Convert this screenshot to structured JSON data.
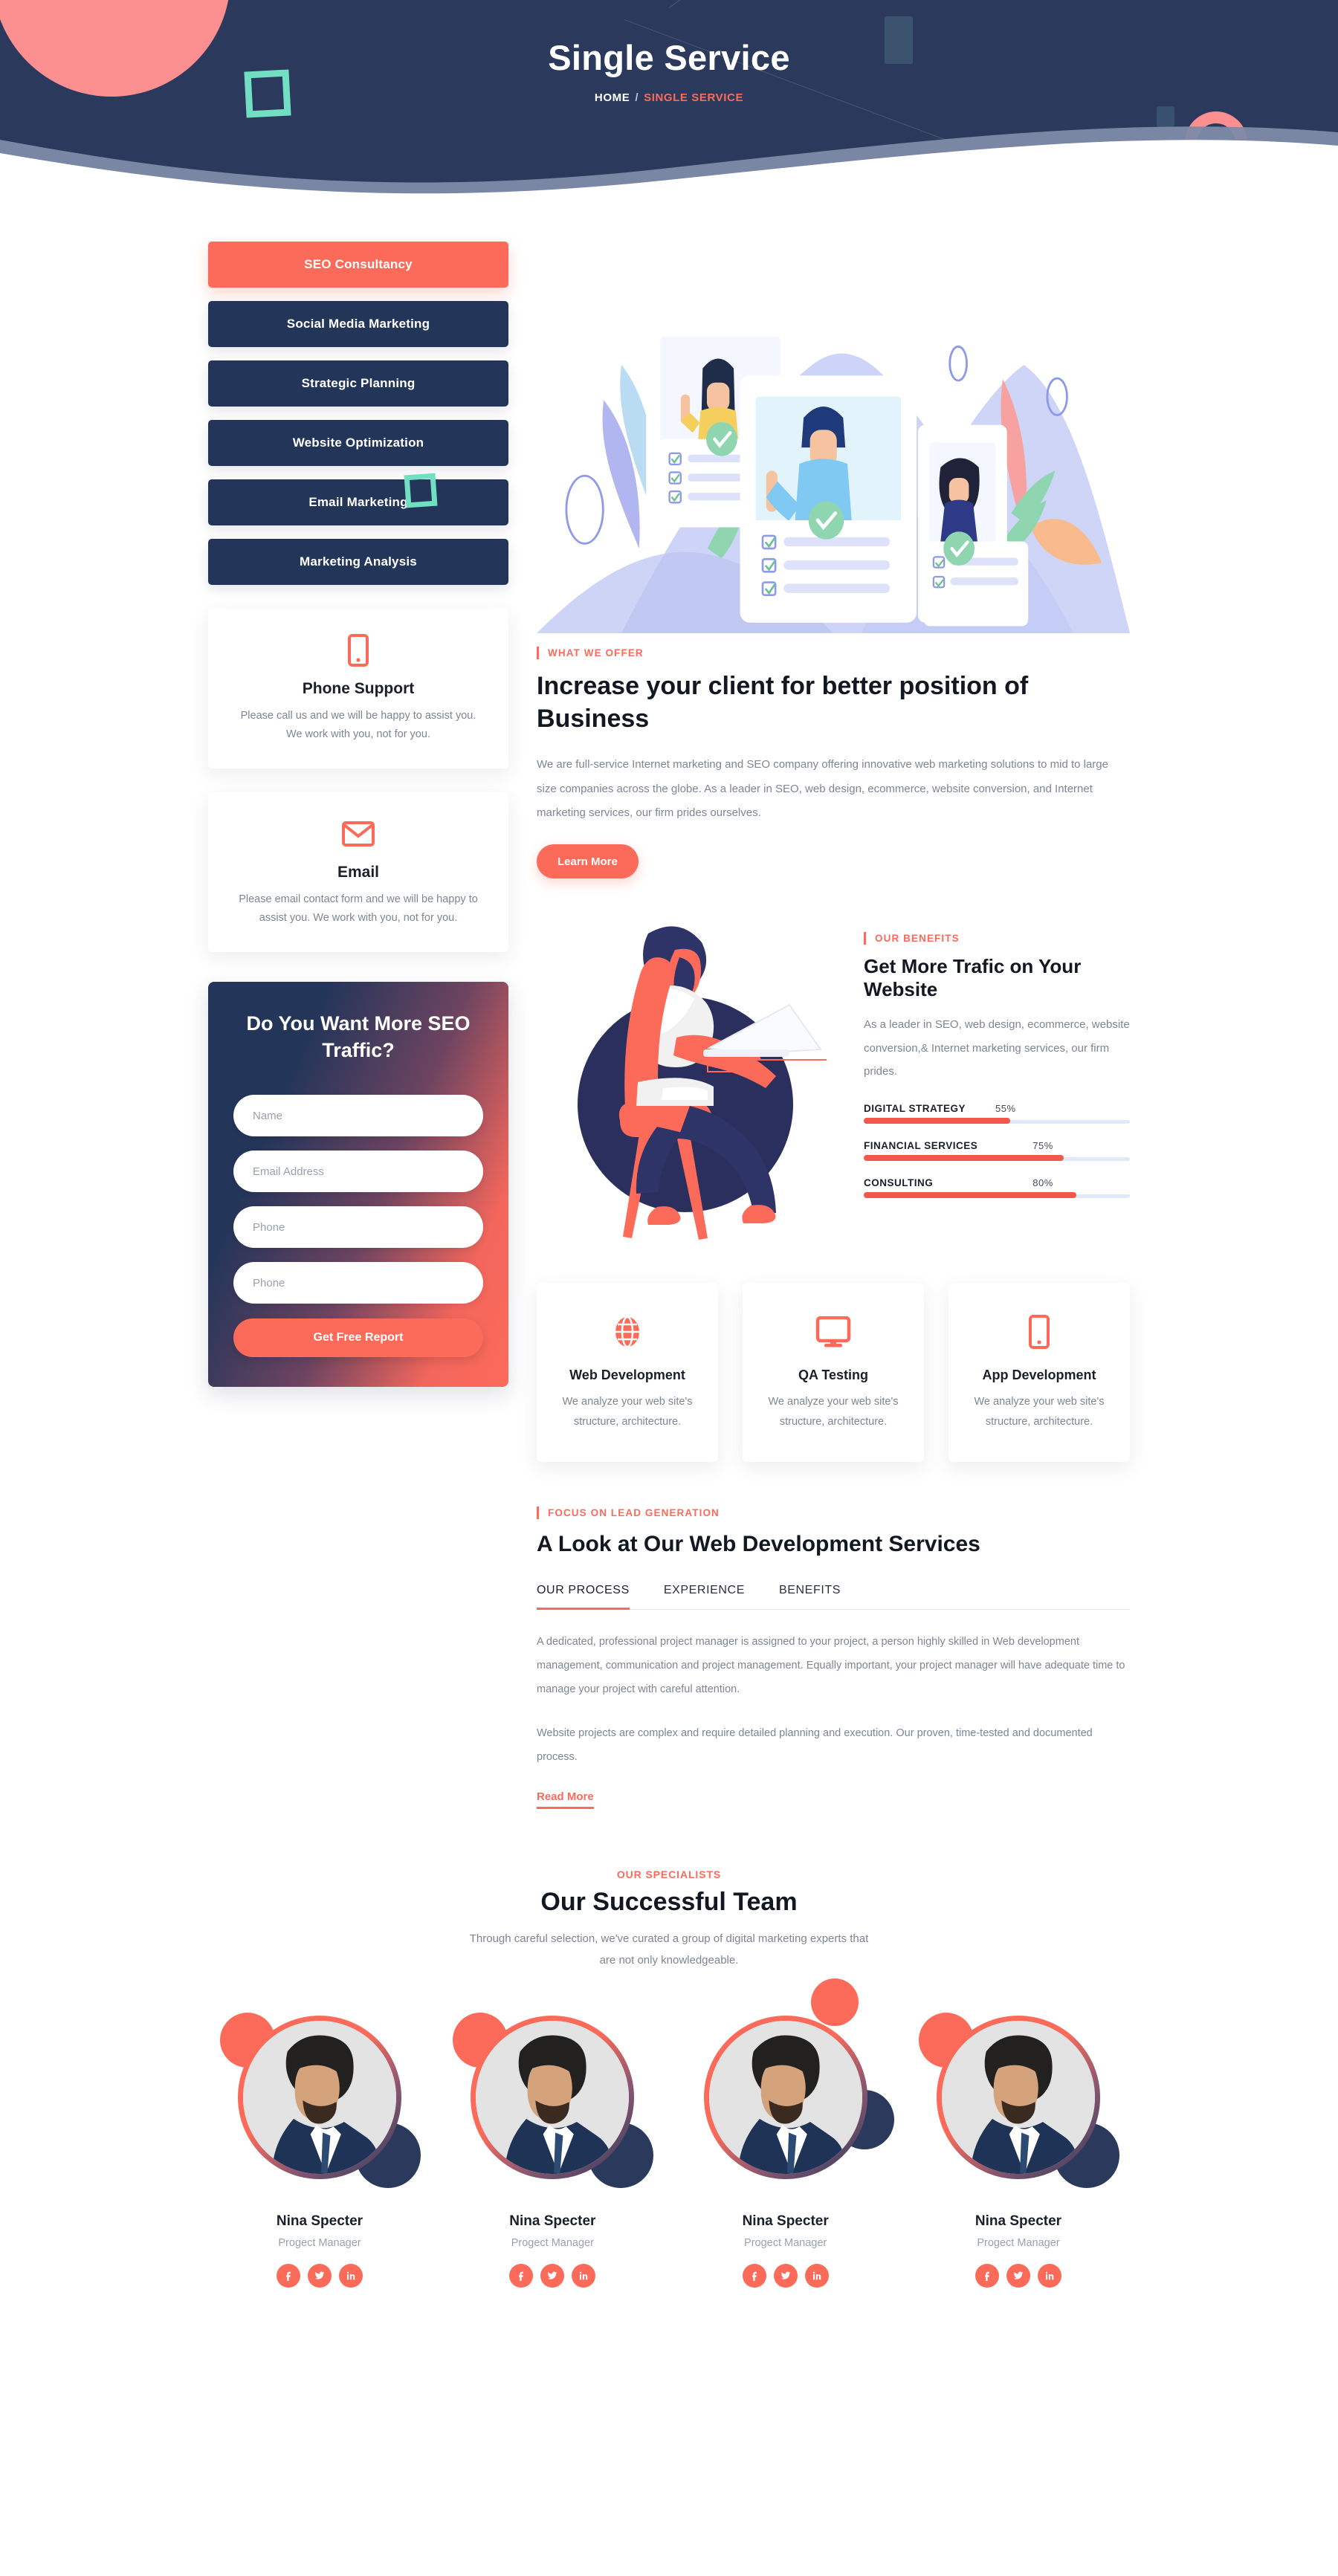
{
  "theme": {
    "navy": "#24355a",
    "coral": "#fc6b5a",
    "teal": "#72dec2",
    "muted": "#7e8593",
    "dark": "#121722"
  },
  "hero": {
    "title": "Single Service",
    "breadcrumb": {
      "home": "HOME",
      "separator": "/",
      "current": "SINGLE SERVICE"
    }
  },
  "sidebar": {
    "services": [
      {
        "label": "SEO Consultancy",
        "active": true
      },
      {
        "label": "Social Media Marketing",
        "active": false
      },
      {
        "label": "Strategic Planning",
        "active": false
      },
      {
        "label": "Website Optimization",
        "active": false
      },
      {
        "label": "Email Marketing",
        "active": false
      },
      {
        "label": "Marketing Analysis",
        "active": false
      }
    ],
    "contact_cards": [
      {
        "icon": "mobile-phone-icon",
        "title": "Phone Support",
        "text": "Please call us and we will be happy to assist you. We work with you, not for you."
      },
      {
        "icon": "envelope-icon",
        "title": "Email",
        "text": "Please email contact form and we will be happy to assist you. We work with you, not for you."
      }
    ],
    "seo_form": {
      "title": "Do You Want More SEO Traffic?",
      "fields": [
        {
          "name": "name",
          "placeholder": "Name",
          "value": ""
        },
        {
          "name": "email",
          "placeholder": "Email Address",
          "value": ""
        },
        {
          "name": "phone",
          "placeholder": "Phone",
          "value": ""
        },
        {
          "name": "phone2",
          "placeholder": "Phone",
          "value": ""
        }
      ],
      "submit_label": "Get Free Report"
    }
  },
  "offer": {
    "eyebrow": "WHAT WE OFFER",
    "heading": "Increase your client for better position of Business",
    "paragraph": "We are full-service Internet marketing and SEO company offering innovative web marketing solutions to mid to large size companies across the globe. As a leader in SEO, web design, ecommerce, website conversion, and Internet marketing services, our firm prides ourselves.",
    "button_label": "Learn More"
  },
  "benefits": {
    "eyebrow": "OUR BENEFITS",
    "heading": "Get More Trafic on Your Website",
    "paragraph": "As a leader in SEO, web design, ecommerce, website conversion,& Internet marketing services, our firm prides."
  },
  "chart_data": {
    "type": "bar",
    "title": "Get More Trafic on Your Website",
    "orientation": "horizontal",
    "categories": [
      "DIGITAL STRATEGY",
      "FINANCIAL SERVICES",
      "CONSULTING"
    ],
    "values": [
      55,
      75,
      80
    ],
    "value_labels": [
      "55%",
      "75%",
      "80%"
    ],
    "xlabel": "",
    "ylabel": "",
    "xlim": [
      0,
      100
    ],
    "grid": false,
    "legend": "none",
    "bar_color": "#f2574a",
    "track_color": "#dfe9f7"
  },
  "features": [
    {
      "icon": "globe-icon",
      "title": "Web Development",
      "text": "We analyze your web site's structure, architecture."
    },
    {
      "icon": "monitor-icon",
      "title": "QA Testing",
      "text": "We analyze your web site's structure, architecture."
    },
    {
      "icon": "mobile-phone-icon",
      "title": "App Development",
      "text": "We analyze your web site's structure, architecture."
    }
  ],
  "lead": {
    "eyebrow": "FOCUS ON LEAD GENERATION",
    "heading": "A Look at Our Web Development Services",
    "tabs": [
      {
        "label": "OUR PROCESS",
        "active": true
      },
      {
        "label": "EXPERIENCE",
        "active": false
      },
      {
        "label": "BENEFITS",
        "active": false
      }
    ],
    "paragraph1": "A dedicated, professional project manager is assigned to your project, a person highly skilled in Web development management, communication and project management. Equally important, your project manager will have adequate time to manage your project with careful attention.",
    "paragraph2": "Website projects are complex and require detailed planning and execution. Our proven, time-tested and documented process.",
    "read_more": "Read More"
  },
  "team": {
    "kicker": "OUR SPECIALISTS",
    "heading": "Our Successful Team",
    "subtitle": "Through careful selection, we've curated a group of digital marketing experts that are not only knowledgeable.",
    "members": [
      {
        "name": "Nina Specter",
        "role": "Progect Manager",
        "socials": [
          "facebook-icon",
          "twitter-icon",
          "linkedin-icon"
        ]
      },
      {
        "name": "Nina Specter",
        "role": "Progect Manager",
        "socials": [
          "facebook-icon",
          "twitter-icon",
          "linkedin-icon"
        ]
      },
      {
        "name": "Nina Specter",
        "role": "Progect Manager",
        "socials": [
          "facebook-icon",
          "twitter-icon",
          "linkedin-icon"
        ]
      },
      {
        "name": "Nina Specter",
        "role": "Progect Manager",
        "socials": [
          "facebook-icon",
          "twitter-icon",
          "linkedin-icon"
        ]
      }
    ]
  }
}
